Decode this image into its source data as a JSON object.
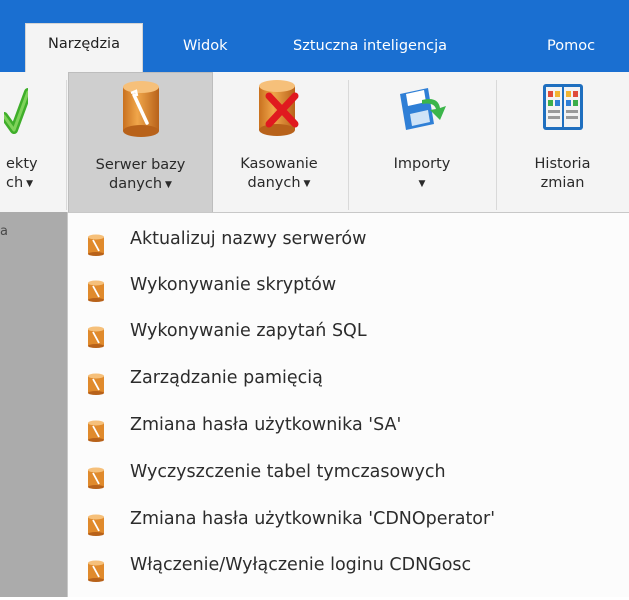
{
  "tabs": [
    {
      "label": "Narzędzia",
      "active": true
    },
    {
      "label": "Widok",
      "active": false
    },
    {
      "label": "Sztuczna inteligencja",
      "active": false
    },
    {
      "label": "Pomoc",
      "active": false
    }
  ],
  "ribbon": {
    "partial_button": {
      "line1": "ekty",
      "line2": "ch"
    },
    "buttons": [
      {
        "line1": "Serwer bazy",
        "line2": "danych",
        "icon": "database-wrench-icon",
        "pressed": true
      },
      {
        "line1": "Kasowanie",
        "line2": "danych",
        "icon": "database-delete-icon",
        "pressed": false
      },
      {
        "line1": "Importy",
        "line2": "",
        "icon": "import-disk-icon",
        "pressed": false
      },
      {
        "line1": "Historia",
        "line2": "zmian",
        "icon": "history-book-icon",
        "pressed": false
      }
    ],
    "group_label_partial": "a"
  },
  "menu": {
    "items": [
      {
        "label": "Aktualizuj nazwy serwerów"
      },
      {
        "label": "Wykonywanie skryptów"
      },
      {
        "label": "Wykonywanie zapytań SQL"
      },
      {
        "label": "Zarządzanie pamięcią"
      },
      {
        "label": "Zmiana hasła użytkownika 'SA'"
      },
      {
        "label": "Wyczyszczenie tabel tymczasowych"
      },
      {
        "label": "Zmiana hasła użytkownika 'CDNOperator'"
      },
      {
        "label": "Włączenie/Wyłączenie loginu CDNGosc"
      }
    ]
  },
  "colors": {
    "tabbar": "#1a6fd1",
    "ribbon": "#f4f4f4",
    "pressed": "#cfcfcf",
    "menu_bg": "#fcfcfc",
    "backdrop": "#a9a9a9"
  }
}
